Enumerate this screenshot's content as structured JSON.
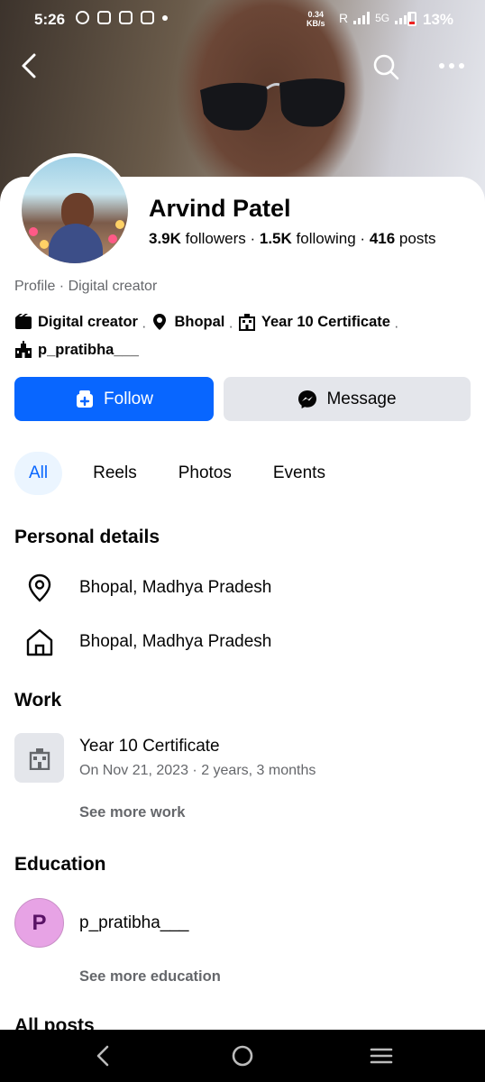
{
  "status_bar": {
    "time": "5:26",
    "net_speed_value": "0.34",
    "net_speed_unit": "KB/s",
    "roaming": "R",
    "network": "5G",
    "battery": "13%"
  },
  "profile": {
    "name": "Arvind Patel",
    "followers_count": "3.9K",
    "followers_label": "followers",
    "following_count": "1.5K",
    "following_label": "following",
    "posts_count": "416",
    "posts_label": "posts",
    "subtitle": "Profile · Digital creator"
  },
  "tagline": {
    "category": "Digital creator",
    "location": "Bhopal",
    "work": "Year 10 Certificate",
    "education": "p_pratibha___",
    "separator": "·"
  },
  "actions": {
    "follow_label": "Follow",
    "message_label": "Message"
  },
  "tabs": [
    {
      "label": "All",
      "active": true
    },
    {
      "label": "Reels",
      "active": false
    },
    {
      "label": "Photos",
      "active": false
    },
    {
      "label": "Events",
      "active": false
    }
  ],
  "personal_details": {
    "title": "Personal details",
    "current_city": "Bhopal, Madhya Pradesh",
    "hometown": "Bhopal, Madhya Pradesh"
  },
  "work": {
    "title": "Work",
    "position": "Year 10 Certificate",
    "date": "On Nov 21, 2023 · 2 years, 3 months",
    "see_more": "See more work"
  },
  "education": {
    "title": "Education",
    "initial": "P",
    "name": "p_pratibha___",
    "see_more": "See more education"
  },
  "posts": {
    "title": "All posts"
  },
  "colors": {
    "primary": "#0866ff",
    "secondary_bg": "#e4e6eb",
    "muted_text": "#65676b",
    "tab_active_bg": "#ebf5ff"
  }
}
